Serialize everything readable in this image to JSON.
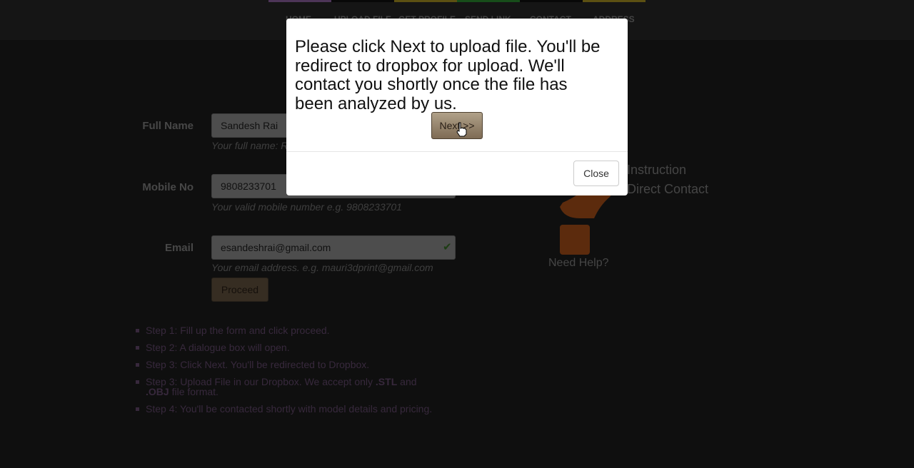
{
  "nav": {
    "items": [
      "HOME",
      "UPLOAD FILE",
      "GET PROFILE",
      "SEND LINK",
      "CONTACT",
      "ADDRESS"
    ],
    "stripe_colors": [
      "#9b6bb0",
      "#111111",
      "#b8a025",
      "#2f9a35",
      "#111111",
      "#b8a025"
    ]
  },
  "form": {
    "full_name": {
      "label": "Full Name",
      "value": "Sandesh Rai",
      "help": "Your full name: R"
    },
    "mobile": {
      "label": "Mobile No",
      "value": "9808233701",
      "help": "Your valid mobile number e.g. 9808233701"
    },
    "email": {
      "label": "Email",
      "value": "esandeshrai@gmail.com",
      "help": "Your email address. e.g. mauri3dprint@gmail.com"
    },
    "proceed_label": "Proceed"
  },
  "steps": [
    {
      "text": "Step 1: Fill up the form and click proceed."
    },
    {
      "text": "Step 2: A dialogue box will open."
    },
    {
      "text": "Step 3: Click Next. You'll be redirected to Dropbox."
    },
    {
      "pre": "Step 3: Upload File in our Dropbox. We accept only ",
      "b1": ".STL",
      "mid": " and ",
      "b2": ".OBJ",
      "post": " file format."
    },
    {
      "text": "Step 4: You'll be contacted shortly with model details and pricing."
    }
  ],
  "help_panel": {
    "line1": "Instruction",
    "line2": "Direct Contact",
    "need_help": "Need Help?",
    "icon": "question-mark-icon",
    "accent": "#b8561a"
  },
  "modal": {
    "message": "Please click Next to upload file. You'll be redirect to dropbox for upload. We'll contact you shortly once the file has been analyzed by us.",
    "next_label": "Next >>",
    "close_label": "Close"
  }
}
